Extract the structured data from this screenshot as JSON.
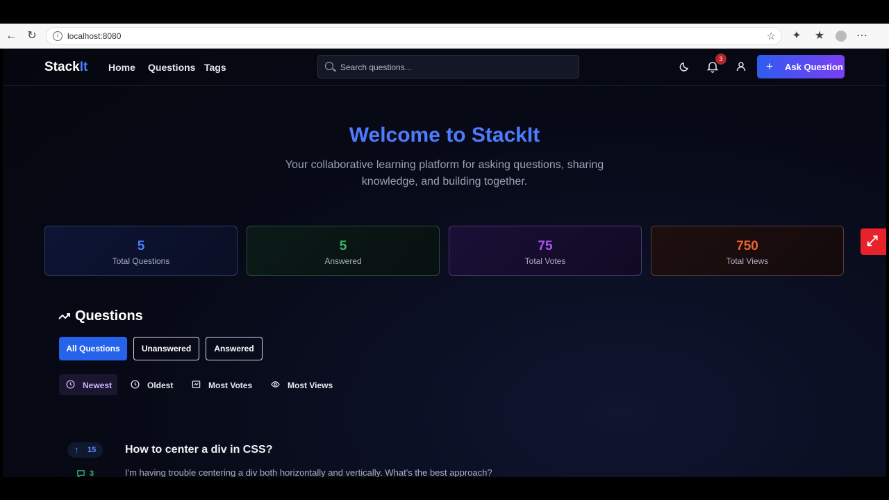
{
  "browser": {
    "url": "localhost:8080"
  },
  "nav": {
    "logo_a": "Stack",
    "logo_b": "It",
    "links": [
      "Home",
      "Questions",
      "Tags"
    ],
    "search_placeholder": "Search questions...",
    "notification_count": "3",
    "ask_label": "Ask Question"
  },
  "hero": {
    "title": "Welcome to StackIt",
    "subtitle": "Your collaborative learning platform for asking questions, sharing knowledge, and building together."
  },
  "stats": [
    {
      "value": "5",
      "label": "Total Questions",
      "color": "#4f7bff"
    },
    {
      "value": "5",
      "label": "Answered",
      "color": "#3ab56b"
    },
    {
      "value": "75",
      "label": "Total Votes",
      "color": "#a855f7"
    },
    {
      "value": "750",
      "label": "Total Views",
      "color": "#f0622e"
    }
  ],
  "questions_section": {
    "title": "Questions",
    "filters": [
      "All Questions",
      "Unanswered",
      "Answered"
    ],
    "sorts": [
      "Newest",
      "Oldest",
      "Most Votes",
      "Most Views"
    ]
  },
  "question_list": [
    {
      "votes": "15",
      "answers": "3",
      "title": "How to center a div in CSS?",
      "excerpt": "I'm having trouble centering a div both horizontally and vertically. What's the best approach?"
    }
  ]
}
